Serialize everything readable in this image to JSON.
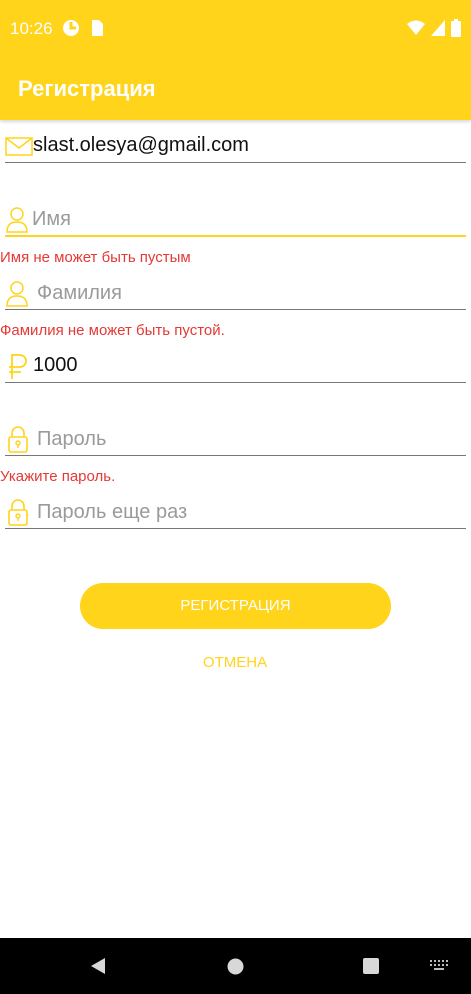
{
  "status": {
    "time": "10:26"
  },
  "app_bar": {
    "title": "Регистрация"
  },
  "form": {
    "email": {
      "value": "slast.olesya@gmail.com"
    },
    "first_name": {
      "placeholder": "Имя",
      "error": "Имя не может быть пустым"
    },
    "last_name": {
      "placeholder": "Фамилия",
      "error": "Фамилия не может быть пустой."
    },
    "amount": {
      "value": "1000"
    },
    "password": {
      "placeholder": "Пароль",
      "error": "Укажите пароль."
    },
    "password_repeat": {
      "placeholder": "Пароль еще раз"
    }
  },
  "buttons": {
    "register": "РЕГИСТРАЦИЯ",
    "cancel": "ОТМЕНА"
  },
  "colors": {
    "accent": "#ffd41a",
    "error": "#e53935"
  },
  "icons": [
    "mail-icon",
    "person-icon",
    "ruble-icon",
    "lock-icon",
    "back-icon",
    "home-icon",
    "recents-icon",
    "keyboard-icon"
  ]
}
